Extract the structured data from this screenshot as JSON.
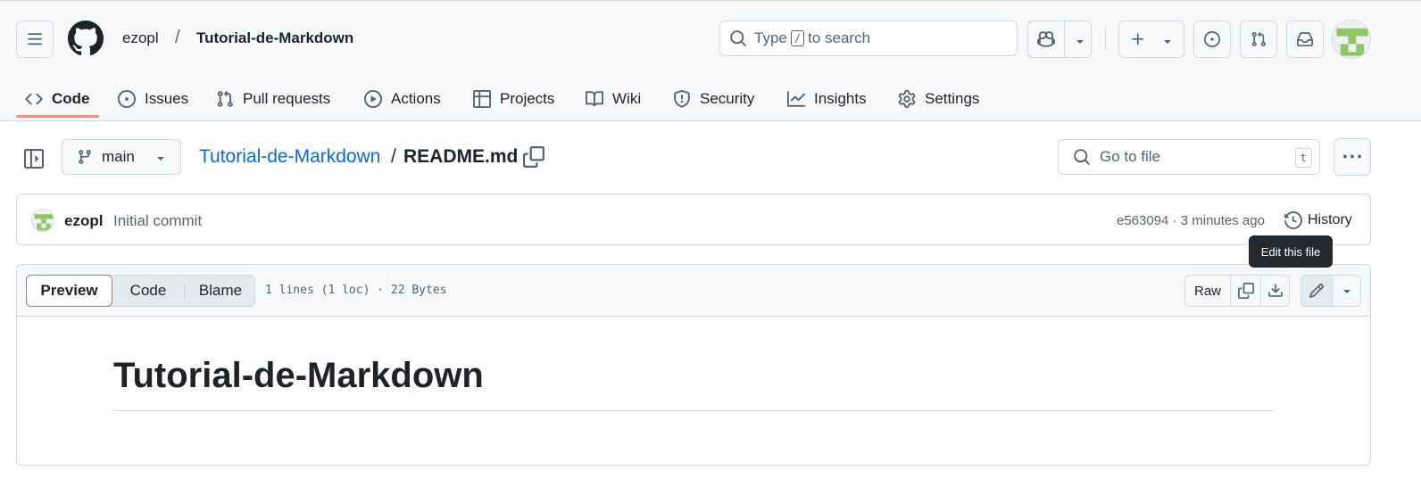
{
  "header": {
    "owner": "ezopl",
    "separator": "/",
    "repo": "Tutorial-de-Markdown",
    "search": {
      "before": "Type",
      "key": "/",
      "after": "to search"
    }
  },
  "tabs": [
    {
      "label": "Code",
      "icon": "code-icon",
      "active": true
    },
    {
      "label": "Issues",
      "icon": "issue-icon"
    },
    {
      "label": "Pull requests",
      "icon": "pull-request-icon"
    },
    {
      "label": "Actions",
      "icon": "play-icon"
    },
    {
      "label": "Projects",
      "icon": "table-icon"
    },
    {
      "label": "Wiki",
      "icon": "book-icon"
    },
    {
      "label": "Security",
      "icon": "shield-icon"
    },
    {
      "label": "Insights",
      "icon": "graph-icon"
    },
    {
      "label": "Settings",
      "icon": "gear-icon"
    }
  ],
  "file_nav": {
    "branch": "main",
    "breadcrumb_repo": "Tutorial-de-Markdown",
    "breadcrumb_sep": "/",
    "breadcrumb_file": "README.md",
    "goto_placeholder": "Go to file",
    "goto_key": "t"
  },
  "commit": {
    "author": "ezopl",
    "message": "Initial commit",
    "meta": "e563094 · 3 minutes ago",
    "history_label": "History"
  },
  "tooltip": "Edit this file",
  "file_header": {
    "view_tabs": [
      "Preview",
      "Code",
      "Blame"
    ],
    "active_view": "Preview",
    "info": "1 lines (1 loc) · 22 Bytes",
    "raw_label": "Raw"
  },
  "readme": {
    "heading": "Tutorial-de-Markdown"
  },
  "colors": {
    "link": "#0969da",
    "active_tab_underline": "#fd8c73",
    "avatar_green": "#8cc665"
  }
}
